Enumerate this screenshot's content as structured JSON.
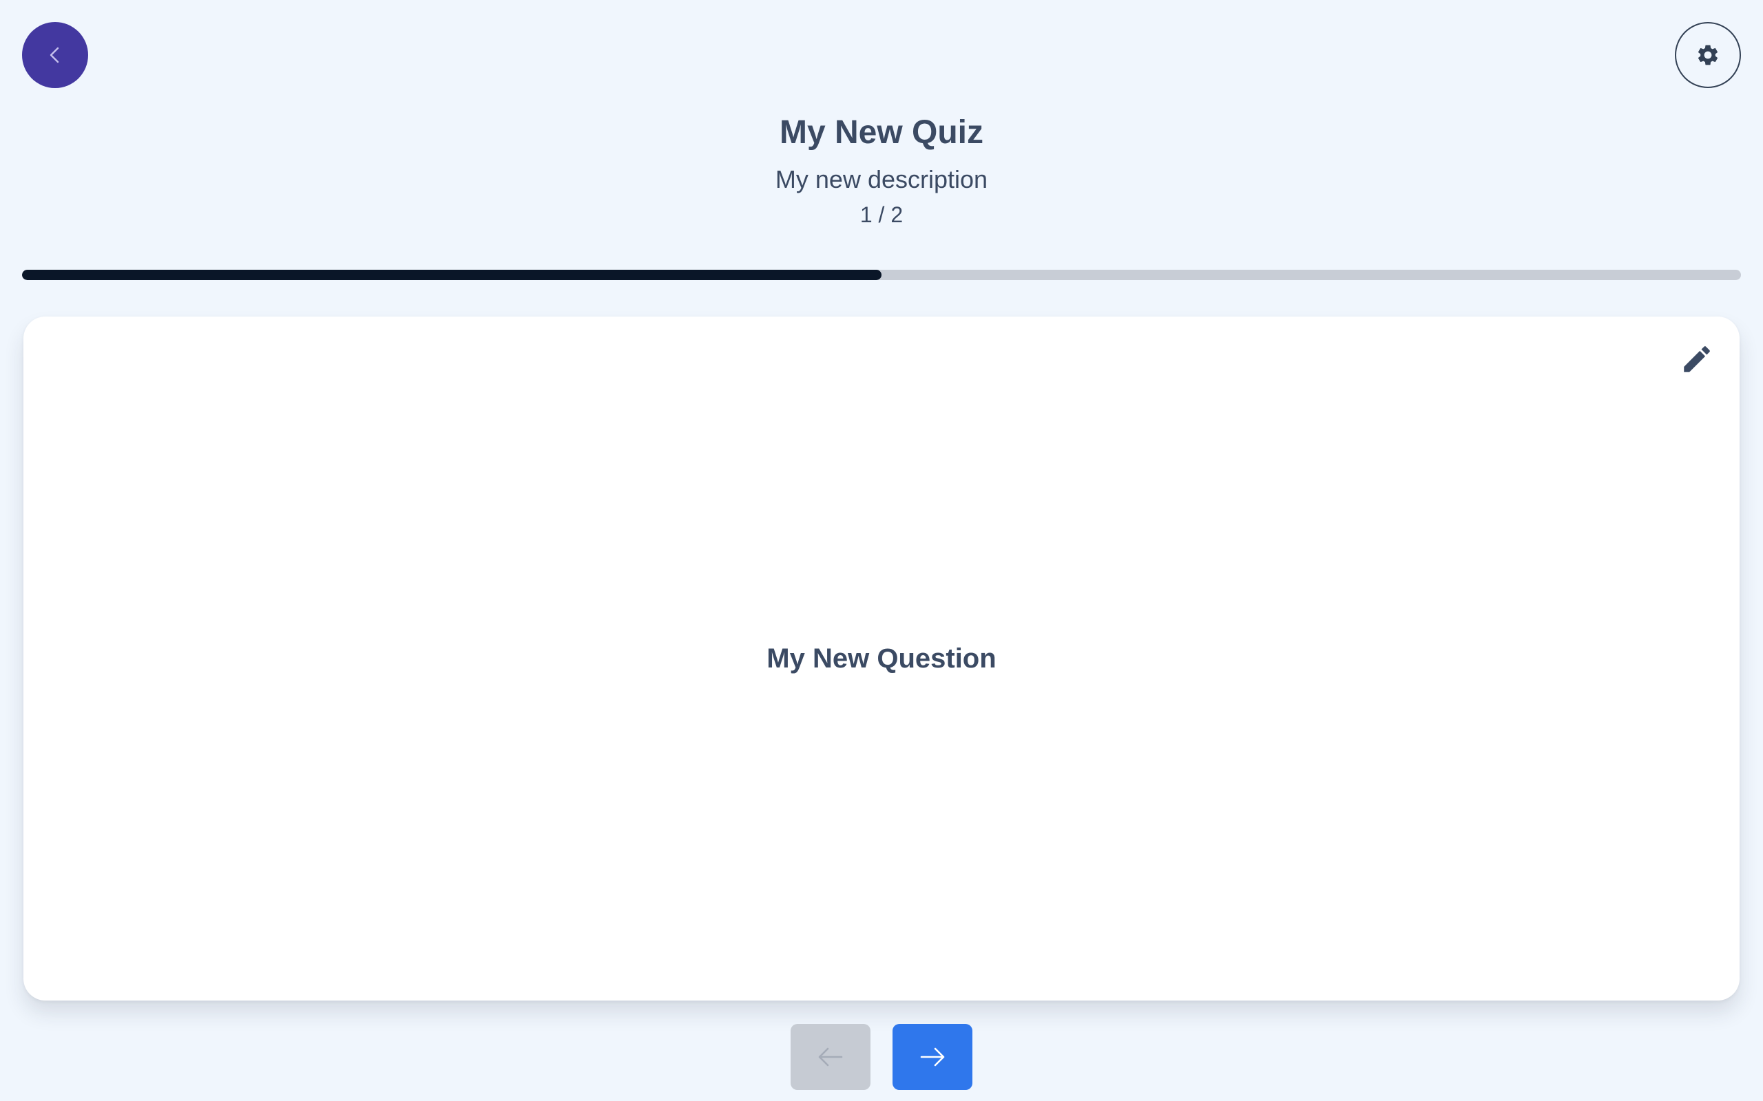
{
  "quiz": {
    "title": "My New Quiz",
    "description": "My new description",
    "counter": "1 / 2",
    "progress_fraction": 0.5
  },
  "card": {
    "question": "My New Question"
  },
  "icons": {
    "back": "chevron-left-icon",
    "settings": "gear-icon",
    "edit": "pencil-icon",
    "previous": "arrow-left-icon",
    "next": "arrow-right-icon"
  },
  "colors": {
    "background": "#f0f6fd",
    "back_button": "#4338a0",
    "progress_fill": "#0a1628",
    "progress_track": "#c8cdd6",
    "next_button": "#2f77ec",
    "prev_button_disabled": "#c6cbd3",
    "text": "#3b4a63"
  }
}
